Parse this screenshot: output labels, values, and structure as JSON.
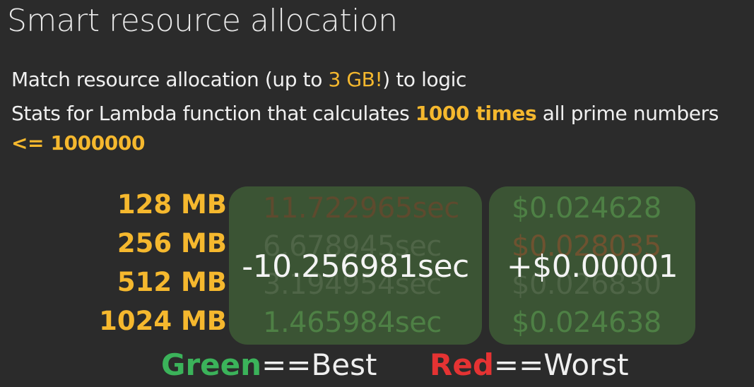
{
  "slide": {
    "title": "Smart resource allocation",
    "line1": {
      "before": "Match resource allocation (up to ",
      "highlight": "3 GB!",
      "after": ") to logic"
    },
    "line2": {
      "before": "Stats for Lambda function that calculates ",
      "highlight": "1000 times",
      "after": " all prime numbers"
    },
    "line3": "<= 1000000",
    "memory_sizes": [
      "128 MB",
      "256 MB",
      "512 MB",
      "1024 MB"
    ],
    "durations": [
      "11.722965sec",
      "6.678945sec",
      "3.194954sec",
      "1.465984sec"
    ],
    "costs": [
      "$0.024628",
      "$0.028035",
      "$0.026830",
      "$0.024638"
    ],
    "time_delta": "-10.256981sec",
    "cost_delta": "+$0.00001",
    "legend": {
      "green_word": "Green",
      "best_suffix": "==Best",
      "red_word": "Red",
      "worst_suffix": "==Worst"
    },
    "colors": {
      "background": "#2b2b2b",
      "highlight": "#f5b82e",
      "green": "#3bb35a",
      "red": "#e53333",
      "box": "#3b5434"
    }
  }
}
